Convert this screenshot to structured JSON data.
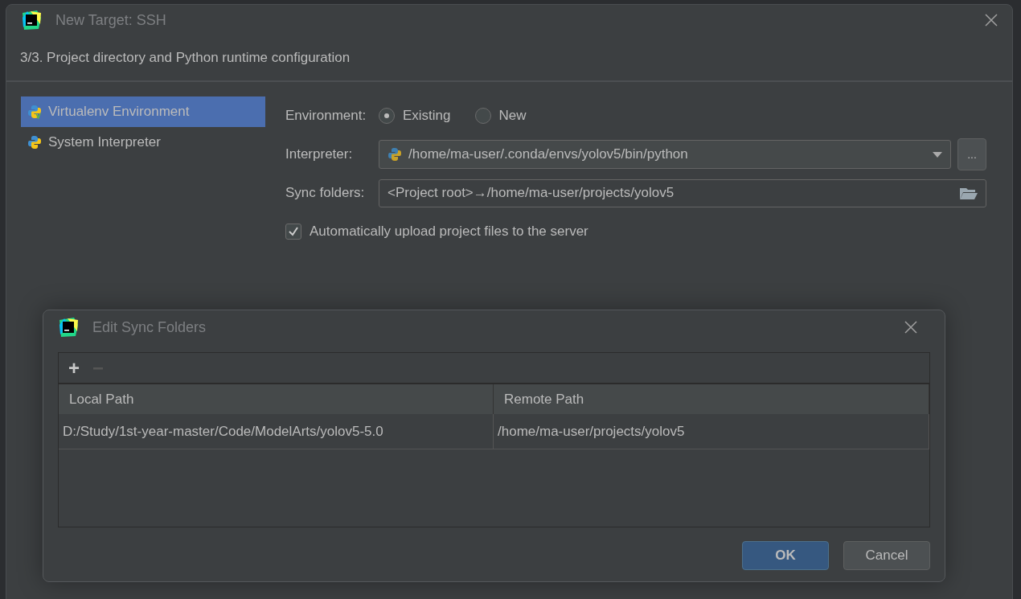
{
  "dialog": {
    "title": "New Target: SSH",
    "step": "3/3. Project directory and Python runtime configuration"
  },
  "sidebar": {
    "items": [
      {
        "label": "Virtualenv Environment",
        "kind": "virtualenv",
        "selected": true
      },
      {
        "label": "System Interpreter",
        "kind": "system",
        "selected": false
      }
    ]
  },
  "form": {
    "environment_label": "Environment:",
    "environment_options": [
      {
        "label": "Existing",
        "selected": true
      },
      {
        "label": "New",
        "selected": false
      }
    ],
    "interpreter_label": "Interpreter:",
    "interpreter_value": "/home/ma-user/.conda/envs/yolov5/bin/python",
    "browse_button": "...",
    "sync_label": "Sync folders:",
    "sync_value": "<Project root>→/home/ma-user/projects/yolov5",
    "auto_upload": {
      "label": "Automatically upload project files to the server",
      "checked": true
    }
  },
  "sync_dialog": {
    "title": "Edit Sync Folders",
    "toolbar": [
      {
        "label": "+",
        "disabled": false
      },
      {
        "label": "−",
        "disabled": true
      }
    ],
    "columns": [
      "Local Path",
      "Remote Path"
    ],
    "rows": [
      [
        "D:/Study/1st-year-master/Code/ModelArts/yolov5-5.0",
        "/home/ma-user/projects/yolov5"
      ]
    ],
    "buttons": [
      {
        "label": "OK",
        "kind": "primary"
      },
      {
        "label": "Cancel",
        "kind": "secondary"
      }
    ]
  }
}
